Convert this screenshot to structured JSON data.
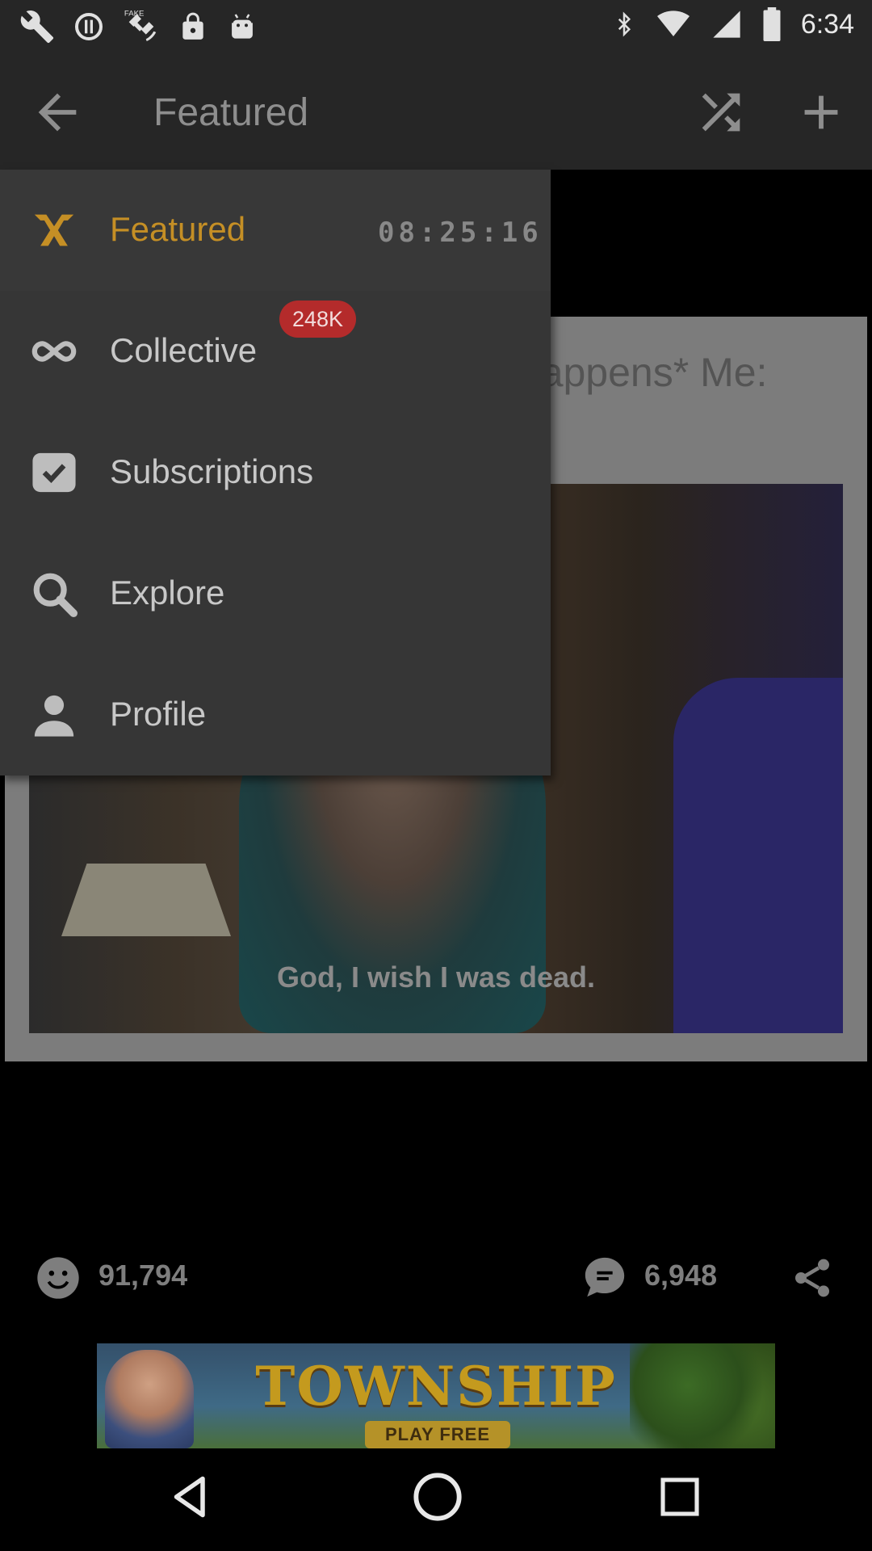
{
  "status_bar": {
    "time": "6:34",
    "icons": [
      "wrench-icon",
      "data-saver-icon",
      "fake-gps-icon",
      "lock-icon",
      "android-icon",
      "bluetooth-icon",
      "wifi-icon",
      "signal-icon",
      "battery-icon"
    ]
  },
  "appbar": {
    "title": "Featured",
    "back_icon": "arrow-back-icon",
    "shuffle_icon": "shuffle-icon",
    "add_icon": "plus-icon"
  },
  "drawer": {
    "items": [
      {
        "label": "Featured",
        "icon": "featured-logo-icon",
        "timer": "08:25:16",
        "active": true
      },
      {
        "label": "Collective",
        "icon": "infinity-icon",
        "badge": "248K"
      },
      {
        "label": "Subscriptions",
        "icon": "checkbox-icon"
      },
      {
        "label": "Explore",
        "icon": "search-icon"
      },
      {
        "label": "Profile",
        "icon": "person-icon"
      }
    ]
  },
  "post": {
    "caption": "Any minor inconvenience: *happens* Me:",
    "image_subtitle": "God, I wish I was dead."
  },
  "actions": {
    "likes": "91,794",
    "comments": "6,948"
  },
  "ad": {
    "title": "TOWNSHIP",
    "cta": "PLAY FREE"
  },
  "colors": {
    "accent": "#c58f25",
    "badge": "#b42b2b",
    "drawer_bg": "#363636"
  }
}
